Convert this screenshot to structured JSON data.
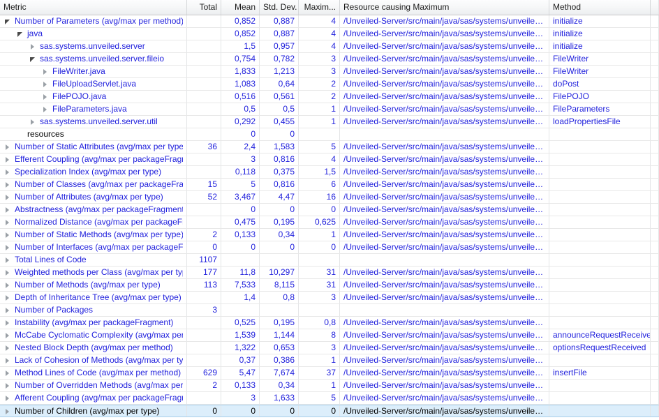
{
  "table": {
    "columns": [
      {
        "key": "metric",
        "label": "Metric",
        "align": "left"
      },
      {
        "key": "total",
        "label": "Total",
        "align": "right"
      },
      {
        "key": "mean",
        "label": "Mean",
        "align": "right"
      },
      {
        "key": "stddev",
        "label": "Std. Dev.",
        "align": "right"
      },
      {
        "key": "maximum",
        "label": "Maxim...",
        "align": "right"
      },
      {
        "key": "resource",
        "label": "Resource causing Maximum",
        "align": "left"
      },
      {
        "key": "method",
        "label": "Method",
        "align": "left"
      }
    ],
    "resource_path_truncated": "/Unveiled-Server/src/main/java/sas/systems/unveile…",
    "rows": [
      {
        "indent": 0,
        "twisty": "expanded",
        "metric": "Number of Parameters (avg/max per method)",
        "total": "",
        "mean": "0,852",
        "stddev": "0,887",
        "maximum": "4",
        "resource": "/Unveiled-Server/src/main/java/sas/systems/unveile…",
        "method": "initialize",
        "selected": false,
        "plain": false
      },
      {
        "indent": 1,
        "twisty": "expanded",
        "metric": "java",
        "total": "",
        "mean": "0,852",
        "stddev": "0,887",
        "maximum": "4",
        "resource": "/Unveiled-Server/src/main/java/sas/systems/unveile…",
        "method": "initialize",
        "selected": false,
        "plain": false
      },
      {
        "indent": 2,
        "twisty": "collapsed",
        "metric": "sas.systems.unveiled.server",
        "total": "",
        "mean": "1,5",
        "stddev": "0,957",
        "maximum": "4",
        "resource": "/Unveiled-Server/src/main/java/sas/systems/unveile…",
        "method": "initialize",
        "selected": false,
        "plain": false
      },
      {
        "indent": 2,
        "twisty": "expanded",
        "metric": "sas.systems.unveiled.server.fileio",
        "total": "",
        "mean": "0,754",
        "stddev": "0,782",
        "maximum": "3",
        "resource": "/Unveiled-Server/src/main/java/sas/systems/unveile…",
        "method": "FileWriter",
        "selected": false,
        "plain": false
      },
      {
        "indent": 3,
        "twisty": "collapsed",
        "metric": "FileWriter.java",
        "total": "",
        "mean": "1,833",
        "stddev": "1,213",
        "maximum": "3",
        "resource": "/Unveiled-Server/src/main/java/sas/systems/unveile…",
        "method": "FileWriter",
        "selected": false,
        "plain": false
      },
      {
        "indent": 3,
        "twisty": "collapsed",
        "metric": "FileUploadServlet.java",
        "total": "",
        "mean": "1,083",
        "stddev": "0,64",
        "maximum": "2",
        "resource": "/Unveiled-Server/src/main/java/sas/systems/unveile…",
        "method": "doPost",
        "selected": false,
        "plain": false
      },
      {
        "indent": 3,
        "twisty": "collapsed",
        "metric": "FilePOJO.java",
        "total": "",
        "mean": "0,516",
        "stddev": "0,561",
        "maximum": "2",
        "resource": "/Unveiled-Server/src/main/java/sas/systems/unveile…",
        "method": "FilePOJO",
        "selected": false,
        "plain": false
      },
      {
        "indent": 3,
        "twisty": "collapsed",
        "metric": "FileParameters.java",
        "total": "",
        "mean": "0,5",
        "stddev": "0,5",
        "maximum": "1",
        "resource": "/Unveiled-Server/src/main/java/sas/systems/unveile…",
        "method": "FileParameters",
        "selected": false,
        "plain": false
      },
      {
        "indent": 2,
        "twisty": "collapsed",
        "metric": "sas.systems.unveiled.server.util",
        "total": "",
        "mean": "0,292",
        "stddev": "0,455",
        "maximum": "1",
        "resource": "/Unveiled-Server/src/main/java/sas/systems/unveile…",
        "method": "loadPropertiesFile",
        "selected": false,
        "plain": false
      },
      {
        "indent": 1,
        "twisty": "leaf",
        "metric": "resources",
        "total": "",
        "mean": "0",
        "stddev": "0",
        "maximum": "",
        "resource": "",
        "method": "",
        "selected": false,
        "plain": true
      },
      {
        "indent": 0,
        "twisty": "collapsed",
        "metric": "Number of Static Attributes (avg/max per type)",
        "total": "36",
        "mean": "2,4",
        "stddev": "1,583",
        "maximum": "5",
        "resource": "/Unveiled-Server/src/main/java/sas/systems/unveile…",
        "method": "",
        "selected": false,
        "plain": false
      },
      {
        "indent": 0,
        "twisty": "collapsed",
        "metric": "Efferent Coupling (avg/max per packageFragment)",
        "total": "",
        "mean": "3",
        "stddev": "0,816",
        "maximum": "4",
        "resource": "/Unveiled-Server/src/main/java/sas/systems/unveile…",
        "method": "",
        "selected": false,
        "plain": false
      },
      {
        "indent": 0,
        "twisty": "collapsed",
        "metric": "Specialization Index (avg/max per type)",
        "total": "",
        "mean": "0,118",
        "stddev": "0,375",
        "maximum": "1,5",
        "resource": "/Unveiled-Server/src/main/java/sas/systems/unveile…",
        "method": "",
        "selected": false,
        "plain": false
      },
      {
        "indent": 0,
        "twisty": "collapsed",
        "metric": "Number of Classes (avg/max per packageFragment)",
        "total": "15",
        "mean": "5",
        "stddev": "0,816",
        "maximum": "6",
        "resource": "/Unveiled-Server/src/main/java/sas/systems/unveile…",
        "method": "",
        "selected": false,
        "plain": false
      },
      {
        "indent": 0,
        "twisty": "collapsed",
        "metric": "Number of Attributes (avg/max per type)",
        "total": "52",
        "mean": "3,467",
        "stddev": "4,47",
        "maximum": "16",
        "resource": "/Unveiled-Server/src/main/java/sas/systems/unveile…",
        "method": "",
        "selected": false,
        "plain": false
      },
      {
        "indent": 0,
        "twisty": "collapsed",
        "metric": "Abstractness (avg/max per packageFragment)",
        "total": "",
        "mean": "0",
        "stddev": "0",
        "maximum": "0",
        "resource": "/Unveiled-Server/src/main/java/sas/systems/unveile…",
        "method": "",
        "selected": false,
        "plain": false
      },
      {
        "indent": 0,
        "twisty": "collapsed",
        "metric": "Normalized Distance (avg/max per packageFragment)",
        "total": "",
        "mean": "0,475",
        "stddev": "0,195",
        "maximum": "0,625",
        "resource": "/Unveiled-Server/src/main/java/sas/systems/unveile…",
        "method": "",
        "selected": false,
        "plain": false
      },
      {
        "indent": 0,
        "twisty": "collapsed",
        "metric": "Number of Static Methods (avg/max per type)",
        "total": "2",
        "mean": "0,133",
        "stddev": "0,34",
        "maximum": "1",
        "resource": "/Unveiled-Server/src/main/java/sas/systems/unveile…",
        "method": "",
        "selected": false,
        "plain": false
      },
      {
        "indent": 0,
        "twisty": "collapsed",
        "metric": "Number of Interfaces (avg/max per packageFragment)",
        "total": "0",
        "mean": "0",
        "stddev": "0",
        "maximum": "0",
        "resource": "/Unveiled-Server/src/main/java/sas/systems/unveile…",
        "method": "",
        "selected": false,
        "plain": false
      },
      {
        "indent": 0,
        "twisty": "collapsed",
        "metric": "Total Lines of Code",
        "total": "1107",
        "mean": "",
        "stddev": "",
        "maximum": "",
        "resource": "",
        "method": "",
        "selected": false,
        "plain": false
      },
      {
        "indent": 0,
        "twisty": "collapsed",
        "metric": "Weighted methods per Class (avg/max per type)",
        "total": "177",
        "mean": "11,8",
        "stddev": "10,297",
        "maximum": "31",
        "resource": "/Unveiled-Server/src/main/java/sas/systems/unveile…",
        "method": "",
        "selected": false,
        "plain": false
      },
      {
        "indent": 0,
        "twisty": "collapsed",
        "metric": "Number of Methods (avg/max per type)",
        "total": "113",
        "mean": "7,533",
        "stddev": "8,115",
        "maximum": "31",
        "resource": "/Unveiled-Server/src/main/java/sas/systems/unveile…",
        "method": "",
        "selected": false,
        "plain": false
      },
      {
        "indent": 0,
        "twisty": "collapsed",
        "metric": "Depth of Inheritance Tree (avg/max per type)",
        "total": "",
        "mean": "1,4",
        "stddev": "0,8",
        "maximum": "3",
        "resource": "/Unveiled-Server/src/main/java/sas/systems/unveile…",
        "method": "",
        "selected": false,
        "plain": false
      },
      {
        "indent": 0,
        "twisty": "collapsed",
        "metric": "Number of Packages",
        "total": "3",
        "mean": "",
        "stddev": "",
        "maximum": "",
        "resource": "",
        "method": "",
        "selected": false,
        "plain": false
      },
      {
        "indent": 0,
        "twisty": "collapsed",
        "metric": "Instability (avg/max per packageFragment)",
        "total": "",
        "mean": "0,525",
        "stddev": "0,195",
        "maximum": "0,8",
        "resource": "/Unveiled-Server/src/main/java/sas/systems/unveile…",
        "method": "",
        "selected": false,
        "plain": false
      },
      {
        "indent": 0,
        "twisty": "collapsed",
        "metric": "McCabe Cyclomatic Complexity (avg/max per method)",
        "total": "",
        "mean": "1,539",
        "stddev": "1,144",
        "maximum": "8",
        "resource": "/Unveiled-Server/src/main/java/sas/systems/unveile…",
        "method": "announceRequestReceived",
        "selected": false,
        "plain": false
      },
      {
        "indent": 0,
        "twisty": "collapsed",
        "metric": "Nested Block Depth (avg/max per method)",
        "total": "",
        "mean": "1,322",
        "stddev": "0,653",
        "maximum": "3",
        "resource": "/Unveiled-Server/src/main/java/sas/systems/unveile…",
        "method": "optionsRequestReceived",
        "selected": false,
        "plain": false
      },
      {
        "indent": 0,
        "twisty": "collapsed",
        "metric": "Lack of Cohesion of Methods (avg/max per type)",
        "total": "",
        "mean": "0,37",
        "stddev": "0,386",
        "maximum": "1",
        "resource": "/Unveiled-Server/src/main/java/sas/systems/unveile…",
        "method": "",
        "selected": false,
        "plain": false
      },
      {
        "indent": 0,
        "twisty": "collapsed",
        "metric": "Method Lines of Code (avg/max per method)",
        "total": "629",
        "mean": "5,47",
        "stddev": "7,674",
        "maximum": "37",
        "resource": "/Unveiled-Server/src/main/java/sas/systems/unveile…",
        "method": "insertFile",
        "selected": false,
        "plain": false
      },
      {
        "indent": 0,
        "twisty": "collapsed",
        "metric": "Number of Overridden Methods (avg/max per type)",
        "total": "2",
        "mean": "0,133",
        "stddev": "0,34",
        "maximum": "1",
        "resource": "/Unveiled-Server/src/main/java/sas/systems/unveile…",
        "method": "",
        "selected": false,
        "plain": false
      },
      {
        "indent": 0,
        "twisty": "collapsed",
        "metric": "Afferent Coupling (avg/max per packageFragment)",
        "total": "",
        "mean": "3",
        "stddev": "1,633",
        "maximum": "5",
        "resource": "/Unveiled-Server/src/main/java/sas/systems/unveile…",
        "method": "",
        "selected": false,
        "plain": false
      },
      {
        "indent": 0,
        "twisty": "collapsed",
        "metric": "Number of Children (avg/max per type)",
        "total": "0",
        "mean": "0",
        "stddev": "0",
        "maximum": "0",
        "resource": "/Unveiled-Server/src/main/java/sas/systems/unveile…",
        "method": "",
        "selected": true,
        "plain": false
      }
    ]
  },
  "colors": {
    "link_text": "#2222dd",
    "header_text": "#1a1a1a",
    "selection_bg": "#dceefb",
    "selection_border": "#a8cfeb",
    "grid_line": "#e8e8e8"
  }
}
